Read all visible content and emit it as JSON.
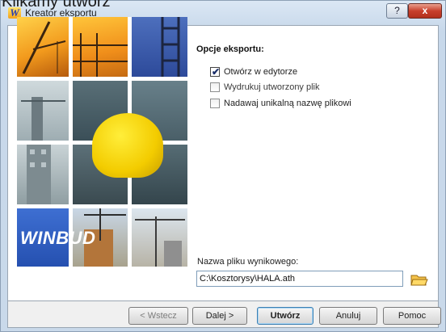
{
  "caption": "Klikamy utwórz",
  "window": {
    "title": "Kreator eksportu",
    "help_glyph": "?",
    "close_glyph": "x"
  },
  "options": {
    "title": "Opcje eksportu:",
    "items": [
      {
        "label": "Otwórz w edytorze",
        "checked": true
      },
      {
        "label": "Wydrukuj utworzony plik",
        "checked": false
      },
      {
        "label": "Nadawaj unikalną nazwę plikowi",
        "checked": false
      }
    ]
  },
  "logo": {
    "text": "WINBUD"
  },
  "output": {
    "label": "Nazwa pliku wynikowego:",
    "value": "C:\\Kosztorysy\\HALA.ath"
  },
  "buttons": {
    "back": "< Wstecz",
    "next": "Dalej >",
    "create": "Utwórz",
    "cancel": "Anuluj",
    "help": "Pomoc"
  },
  "colors": {
    "accent": "#3c7fb1",
    "close": "#c8402c",
    "frame": "#c9d9ea"
  }
}
